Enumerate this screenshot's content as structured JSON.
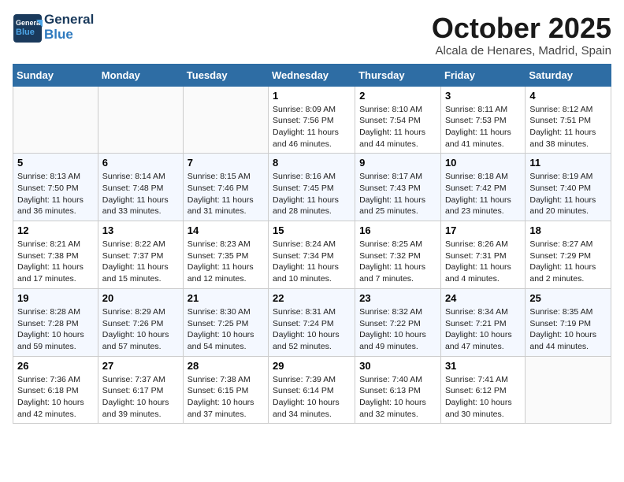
{
  "header": {
    "logo_general": "General",
    "logo_blue": "Blue",
    "month": "October 2025",
    "location": "Alcala de Henares, Madrid, Spain"
  },
  "days_of_week": [
    "Sunday",
    "Monday",
    "Tuesday",
    "Wednesday",
    "Thursday",
    "Friday",
    "Saturday"
  ],
  "weeks": [
    [
      {
        "day": "",
        "info": ""
      },
      {
        "day": "",
        "info": ""
      },
      {
        "day": "",
        "info": ""
      },
      {
        "day": "1",
        "info": "Sunrise: 8:09 AM\nSunset: 7:56 PM\nDaylight: 11 hours and 46 minutes."
      },
      {
        "day": "2",
        "info": "Sunrise: 8:10 AM\nSunset: 7:54 PM\nDaylight: 11 hours and 44 minutes."
      },
      {
        "day": "3",
        "info": "Sunrise: 8:11 AM\nSunset: 7:53 PM\nDaylight: 11 hours and 41 minutes."
      },
      {
        "day": "4",
        "info": "Sunrise: 8:12 AM\nSunset: 7:51 PM\nDaylight: 11 hours and 38 minutes."
      }
    ],
    [
      {
        "day": "5",
        "info": "Sunrise: 8:13 AM\nSunset: 7:50 PM\nDaylight: 11 hours and 36 minutes."
      },
      {
        "day": "6",
        "info": "Sunrise: 8:14 AM\nSunset: 7:48 PM\nDaylight: 11 hours and 33 minutes."
      },
      {
        "day": "7",
        "info": "Sunrise: 8:15 AM\nSunset: 7:46 PM\nDaylight: 11 hours and 31 minutes."
      },
      {
        "day": "8",
        "info": "Sunrise: 8:16 AM\nSunset: 7:45 PM\nDaylight: 11 hours and 28 minutes."
      },
      {
        "day": "9",
        "info": "Sunrise: 8:17 AM\nSunset: 7:43 PM\nDaylight: 11 hours and 25 minutes."
      },
      {
        "day": "10",
        "info": "Sunrise: 8:18 AM\nSunset: 7:42 PM\nDaylight: 11 hours and 23 minutes."
      },
      {
        "day": "11",
        "info": "Sunrise: 8:19 AM\nSunset: 7:40 PM\nDaylight: 11 hours and 20 minutes."
      }
    ],
    [
      {
        "day": "12",
        "info": "Sunrise: 8:21 AM\nSunset: 7:38 PM\nDaylight: 11 hours and 17 minutes."
      },
      {
        "day": "13",
        "info": "Sunrise: 8:22 AM\nSunset: 7:37 PM\nDaylight: 11 hours and 15 minutes."
      },
      {
        "day": "14",
        "info": "Sunrise: 8:23 AM\nSunset: 7:35 PM\nDaylight: 11 hours and 12 minutes."
      },
      {
        "day": "15",
        "info": "Sunrise: 8:24 AM\nSunset: 7:34 PM\nDaylight: 11 hours and 10 minutes."
      },
      {
        "day": "16",
        "info": "Sunrise: 8:25 AM\nSunset: 7:32 PM\nDaylight: 11 hours and 7 minutes."
      },
      {
        "day": "17",
        "info": "Sunrise: 8:26 AM\nSunset: 7:31 PM\nDaylight: 11 hours and 4 minutes."
      },
      {
        "day": "18",
        "info": "Sunrise: 8:27 AM\nSunset: 7:29 PM\nDaylight: 11 hours and 2 minutes."
      }
    ],
    [
      {
        "day": "19",
        "info": "Sunrise: 8:28 AM\nSunset: 7:28 PM\nDaylight: 10 hours and 59 minutes."
      },
      {
        "day": "20",
        "info": "Sunrise: 8:29 AM\nSunset: 7:26 PM\nDaylight: 10 hours and 57 minutes."
      },
      {
        "day": "21",
        "info": "Sunrise: 8:30 AM\nSunset: 7:25 PM\nDaylight: 10 hours and 54 minutes."
      },
      {
        "day": "22",
        "info": "Sunrise: 8:31 AM\nSunset: 7:24 PM\nDaylight: 10 hours and 52 minutes."
      },
      {
        "day": "23",
        "info": "Sunrise: 8:32 AM\nSunset: 7:22 PM\nDaylight: 10 hours and 49 minutes."
      },
      {
        "day": "24",
        "info": "Sunrise: 8:34 AM\nSunset: 7:21 PM\nDaylight: 10 hours and 47 minutes."
      },
      {
        "day": "25",
        "info": "Sunrise: 8:35 AM\nSunset: 7:19 PM\nDaylight: 10 hours and 44 minutes."
      }
    ],
    [
      {
        "day": "26",
        "info": "Sunrise: 7:36 AM\nSunset: 6:18 PM\nDaylight: 10 hours and 42 minutes."
      },
      {
        "day": "27",
        "info": "Sunrise: 7:37 AM\nSunset: 6:17 PM\nDaylight: 10 hours and 39 minutes."
      },
      {
        "day": "28",
        "info": "Sunrise: 7:38 AM\nSunset: 6:15 PM\nDaylight: 10 hours and 37 minutes."
      },
      {
        "day": "29",
        "info": "Sunrise: 7:39 AM\nSunset: 6:14 PM\nDaylight: 10 hours and 34 minutes."
      },
      {
        "day": "30",
        "info": "Sunrise: 7:40 AM\nSunset: 6:13 PM\nDaylight: 10 hours and 32 minutes."
      },
      {
        "day": "31",
        "info": "Sunrise: 7:41 AM\nSunset: 6:12 PM\nDaylight: 10 hours and 30 minutes."
      },
      {
        "day": "",
        "info": ""
      }
    ]
  ]
}
